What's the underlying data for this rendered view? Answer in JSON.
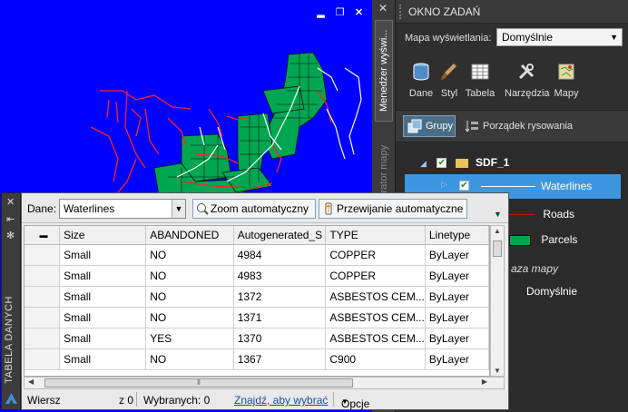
{
  "task_pane": {
    "title": "OKNO ZADAŃ",
    "display_label": "Mapa wyświetlania:",
    "display_value": "Domyślnie",
    "side_tabs": [
      "Menedżer wyświ...",
      "lorator mapy"
    ],
    "tools": [
      "Dane",
      "Styl",
      "Tabela",
      "Narzędzia",
      "Mapy"
    ],
    "groups_button": "Grupy",
    "draw_order": "Porządek rysowania",
    "tree": {
      "root": "SDF_1",
      "layers": [
        "Waterlines",
        "Roads",
        "Parcels"
      ],
      "map_label": "aza mapy",
      "map_item": "Domyślnie"
    }
  },
  "data_table": {
    "side_title": "TABELA DANYCH",
    "data_label": "Dane:",
    "data_value": "Waterlines",
    "zoom_button": "Zoom automatyczny",
    "pan_button": "Przewijanie automatyczne",
    "columns": [
      "Size",
      "ABANDONED",
      "Autogenerated_S",
      "TYPE",
      "Linetype"
    ],
    "rows": [
      [
        "Small",
        "NO",
        "4984",
        "COPPER",
        "ByLayer"
      ],
      [
        "Small",
        "NO",
        "4983",
        "COPPER",
        "ByLayer"
      ],
      [
        "Small",
        "NO",
        "1372",
        "ASBESTOS CEM...",
        "ByLayer"
      ],
      [
        "Small",
        "NO",
        "1371",
        "ASBESTOS CEM...",
        "ByLayer"
      ],
      [
        "Small",
        "YES",
        "1370",
        "ASBESTOS CEM...",
        "ByLayer"
      ],
      [
        "Small",
        "NO",
        "1367",
        "C900",
        "ByLayer"
      ]
    ],
    "status": {
      "rows_label": "Wiersz",
      "rows_of": "z 0",
      "selected": "Wybranych: 0",
      "find_link": "Znajdź, aby wybrać",
      "options": "Opcje"
    }
  },
  "colors": {
    "map_background": "#0000ff",
    "parcels": "#00a651",
    "roads": "#ff0000",
    "waterlines": "#ffffff",
    "selection": "#3d97e0"
  }
}
